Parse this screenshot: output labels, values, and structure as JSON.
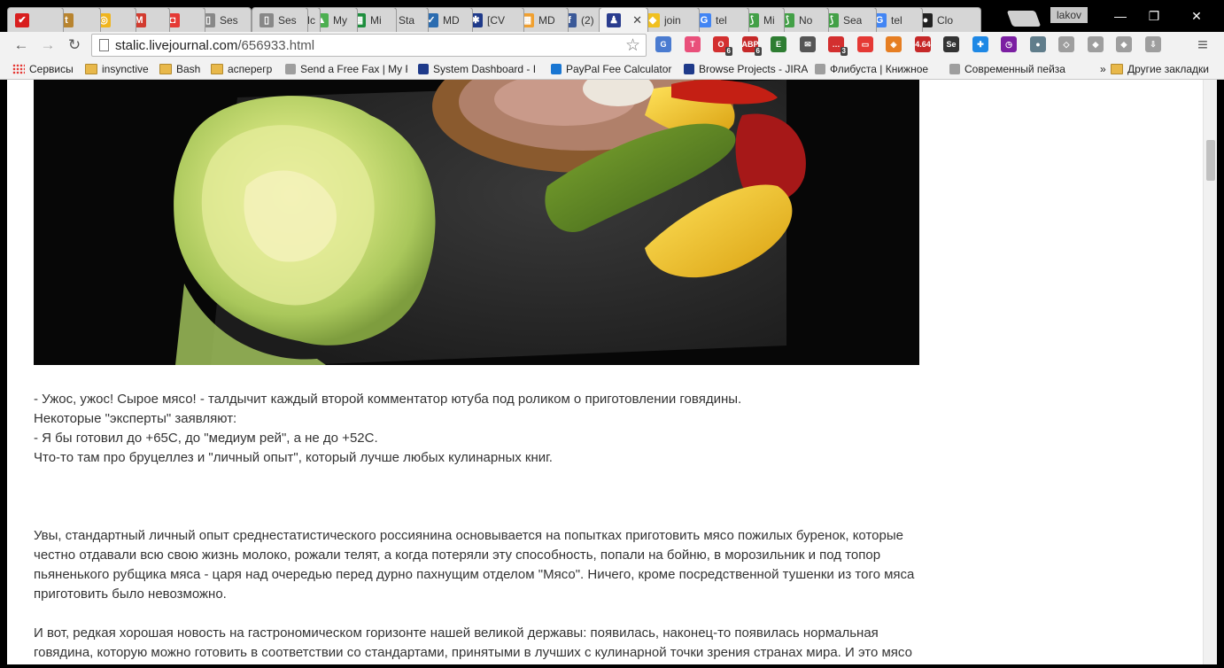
{
  "tabs": [
    {
      "label": "",
      "color": "#d81e1e",
      "glyph": "✔"
    },
    {
      "label": "",
      "color": "#b8842f",
      "glyph": "t"
    },
    {
      "label": "",
      "color": "#f0b51e",
      "glyph": "◎"
    },
    {
      "label": "",
      "color": "#d23b2f",
      "glyph": "M"
    },
    {
      "label": "",
      "color": "#e53935",
      "glyph": "◘"
    },
    {
      "label": "Ses",
      "color": "#888888",
      "glyph": "▯"
    },
    {
      "label": "Ses",
      "color": "#888888",
      "glyph": "▯"
    },
    {
      "label": "Mc",
      "color": "#8a1a1a",
      "glyph": "K"
    },
    {
      "label": "My",
      "color": "#4caf50",
      "glyph": "▲"
    },
    {
      "label": "Mi",
      "color": "#1e8e3e",
      "glyph": "▦"
    },
    {
      "label": "Sta",
      "color": "#d89a2a",
      "glyph": "⌂"
    },
    {
      "label": "MD",
      "color": "#2b6cb0",
      "glyph": "✓"
    },
    {
      "label": "[CV",
      "color": "#1f3a8a",
      "glyph": "✱"
    },
    {
      "label": "MD",
      "color": "#f0a030",
      "glyph": "▦"
    },
    {
      "label": "(2)",
      "color": "#3b5998",
      "glyph": "f"
    },
    {
      "label": "",
      "color": "#2a3d8f",
      "glyph": "♟"
    },
    {
      "label": "join",
      "color": "#f0c020",
      "glyph": "◆"
    },
    {
      "label": "tel",
      "color": "#4285f4",
      "glyph": "G"
    },
    {
      "label": "Mi",
      "color": "#43a047",
      "glyph": "⟆"
    },
    {
      "label": "No",
      "color": "#43a047",
      "glyph": "⟆"
    },
    {
      "label": "Sea",
      "color": "#43a047",
      "glyph": "⟆"
    },
    {
      "label": "tel",
      "color": "#4285f4",
      "glyph": "G"
    },
    {
      "label": "Clo",
      "color": "#222222",
      "glyph": "●"
    }
  ],
  "active_tab_close": "✕",
  "profile_name": "lakov",
  "window_controls": {
    "minimize": "—",
    "restore": "❐",
    "close": "✕"
  },
  "toolbar": {
    "back": "←",
    "forward": "→",
    "reload": "↻",
    "url_host": "stalic.livejournal.com",
    "url_path": "/656933.html",
    "bookmark_star": "☆",
    "menu": "≡"
  },
  "extensions": [
    {
      "name": "translate-extension",
      "color": "#4a7bd0",
      "glyph": "G",
      "badge": ""
    },
    {
      "name": "t-extension",
      "color": "#e94f7a",
      "glyph": "T",
      "badge": ""
    },
    {
      "name": "opera-extension",
      "color": "#d32f2f",
      "glyph": "O",
      "badge": "6"
    },
    {
      "name": "adblock-extension",
      "color": "#c62828",
      "glyph": "ABP",
      "badge": "6"
    },
    {
      "name": "evernote-extension",
      "color": "#2e7d32",
      "glyph": "E",
      "badge": ""
    },
    {
      "name": "mail-extension",
      "color": "#555555",
      "glyph": "✉",
      "badge": ""
    },
    {
      "name": "chat-extension",
      "color": "#d32f2f",
      "glyph": "…",
      "badge": "3"
    },
    {
      "name": "tv-extension",
      "color": "#e53935",
      "glyph": "▭",
      "badge": ""
    },
    {
      "name": "market-extension",
      "color": "#e67e22",
      "glyph": "◈",
      "badge": ""
    },
    {
      "name": "speed-extension",
      "color": "#c62828",
      "glyph": "4.64",
      "badge": ""
    },
    {
      "name": "seo-extension",
      "color": "#333333",
      "glyph": "Se",
      "badge": ""
    },
    {
      "name": "proxy-extension",
      "color": "#1e88e5",
      "glyph": "✚",
      "badge": ""
    },
    {
      "name": "clock-extension",
      "color": "#7b1fa2",
      "glyph": "◷",
      "badge": ""
    },
    {
      "name": "bulb-extension",
      "color": "#607d8b",
      "glyph": "●",
      "badge": ""
    },
    {
      "name": "dropbox-extension",
      "color": "#9e9e9e",
      "glyph": "◇",
      "badge": ""
    },
    {
      "name": "diamond-extension",
      "color": "#9e9e9e",
      "glyph": "◆",
      "badge": ""
    },
    {
      "name": "diamond2-extension",
      "color": "#9e9e9e",
      "glyph": "◆",
      "badge": ""
    },
    {
      "name": "download-extension",
      "color": "#9e9e9e",
      "glyph": "⇩",
      "badge": ""
    }
  ],
  "bookmarks": {
    "apps_label": "Сервисы",
    "items": [
      {
        "label": "insynctive",
        "kind": "folder"
      },
      {
        "label": "Bash",
        "kind": "folder"
      },
      {
        "label": "асперегр",
        "kind": "folder"
      },
      {
        "label": "Send a Free Fax | My F",
        "kind": "page"
      },
      {
        "label": "System Dashboard - I",
        "kind": "jira"
      },
      {
        "label": "PayPal Fee Calculator",
        "kind": "sc"
      },
      {
        "label": "Browse Projects - JIRA",
        "kind": "jira"
      },
      {
        "label": "Флибуста | Книжное",
        "kind": "page"
      },
      {
        "label": "Современный пейза",
        "kind": "page"
      }
    ],
    "more": "»",
    "other_label": "Другие закладки"
  },
  "article": {
    "p1": [
      "- Ужос, ужос! Сырое мясо! - талдычит каждый второй комментатор ютуба под роликом о приготовлении говядины.",
      "Некоторые \"эксперты\" заявляют:",
      "- Я бы готовил до +65С, до \"медиум рей\", а не до +52С.",
      "Что-то там про бруцеллез и \"личный опыт\", который лучше любых кулинарных книг."
    ],
    "p2": [
      "Увы, стандартный личный опыт среднестатистического россиянина основывается на попытках приготовить мясо пожилых буренок, которые",
      "честно отдавали всю свою жизнь молоко, рожали телят, а когда потеряли эту способность, попали на бойню, в морозильник и под топор",
      "пьяненького рубщика мяса - царя над очередью перед дурно пахнущим отделом \"Мясо\". Ничего, кроме посредственной тушенки из того мяса",
      "приготовить было невозможно."
    ],
    "p3": [
      "И вот, редкая хорошая новость на гастрономическом горизонте нашей великой державы: появилась, наконец-то появилась нормальная",
      "говядина, которую можно готовить в соответствии со стандартами, принятыми в лучших с кулинарной точки зрения странах мира. И это мясо"
    ]
  }
}
